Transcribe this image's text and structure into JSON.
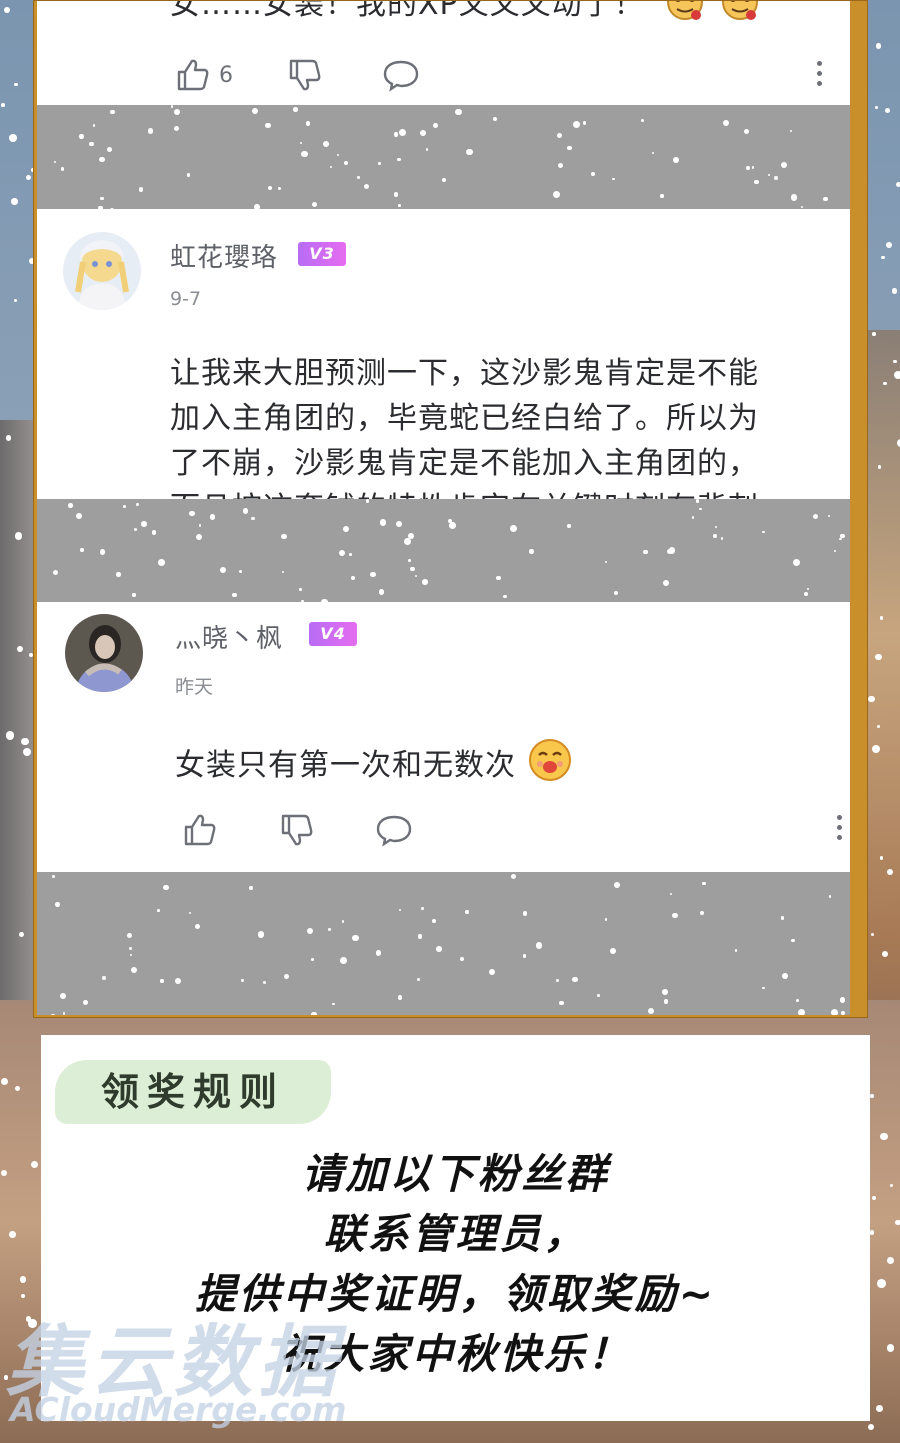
{
  "comments": [
    {
      "partial_text": "女……女装！我的XP又又又动了！",
      "emoji_name": "tiger-face-emoji",
      "likes": "6"
    },
    {
      "username": "虹花瓔珞",
      "level": "V3",
      "date": "9-7",
      "lines": [
        "让我来大胆预测一下，这沙影鬼肯定是不能",
        "加入主角团的，毕竟蛇已经白给了。所以为",
        "了不崩，沙影鬼肯定是不能加入主角团的，",
        "而且按这套钺的特性肯定在关键时刻有背刺"
      ]
    },
    {
      "username": "灬晓丶枫",
      "level": "V4",
      "date": "昨天",
      "text": "女装只有第一次和无数次",
      "emoji_name": "drooling-face-emoji"
    }
  ],
  "rules": {
    "tag": "领奖规则",
    "lines": [
      "请加以下粉丝群",
      "联系管理员，",
      "提供中奖证明，领取奖励~",
      "祝大家中秋快乐！"
    ]
  },
  "watermark": {
    "big": "集云数据",
    "small": "ACloudMerge.com"
  },
  "colors": {
    "frame": "#c98f2a",
    "badge": "#c96cf3",
    "rules_tag_bg": "#dcefd6",
    "gap_gray": "#9e9e9e"
  }
}
